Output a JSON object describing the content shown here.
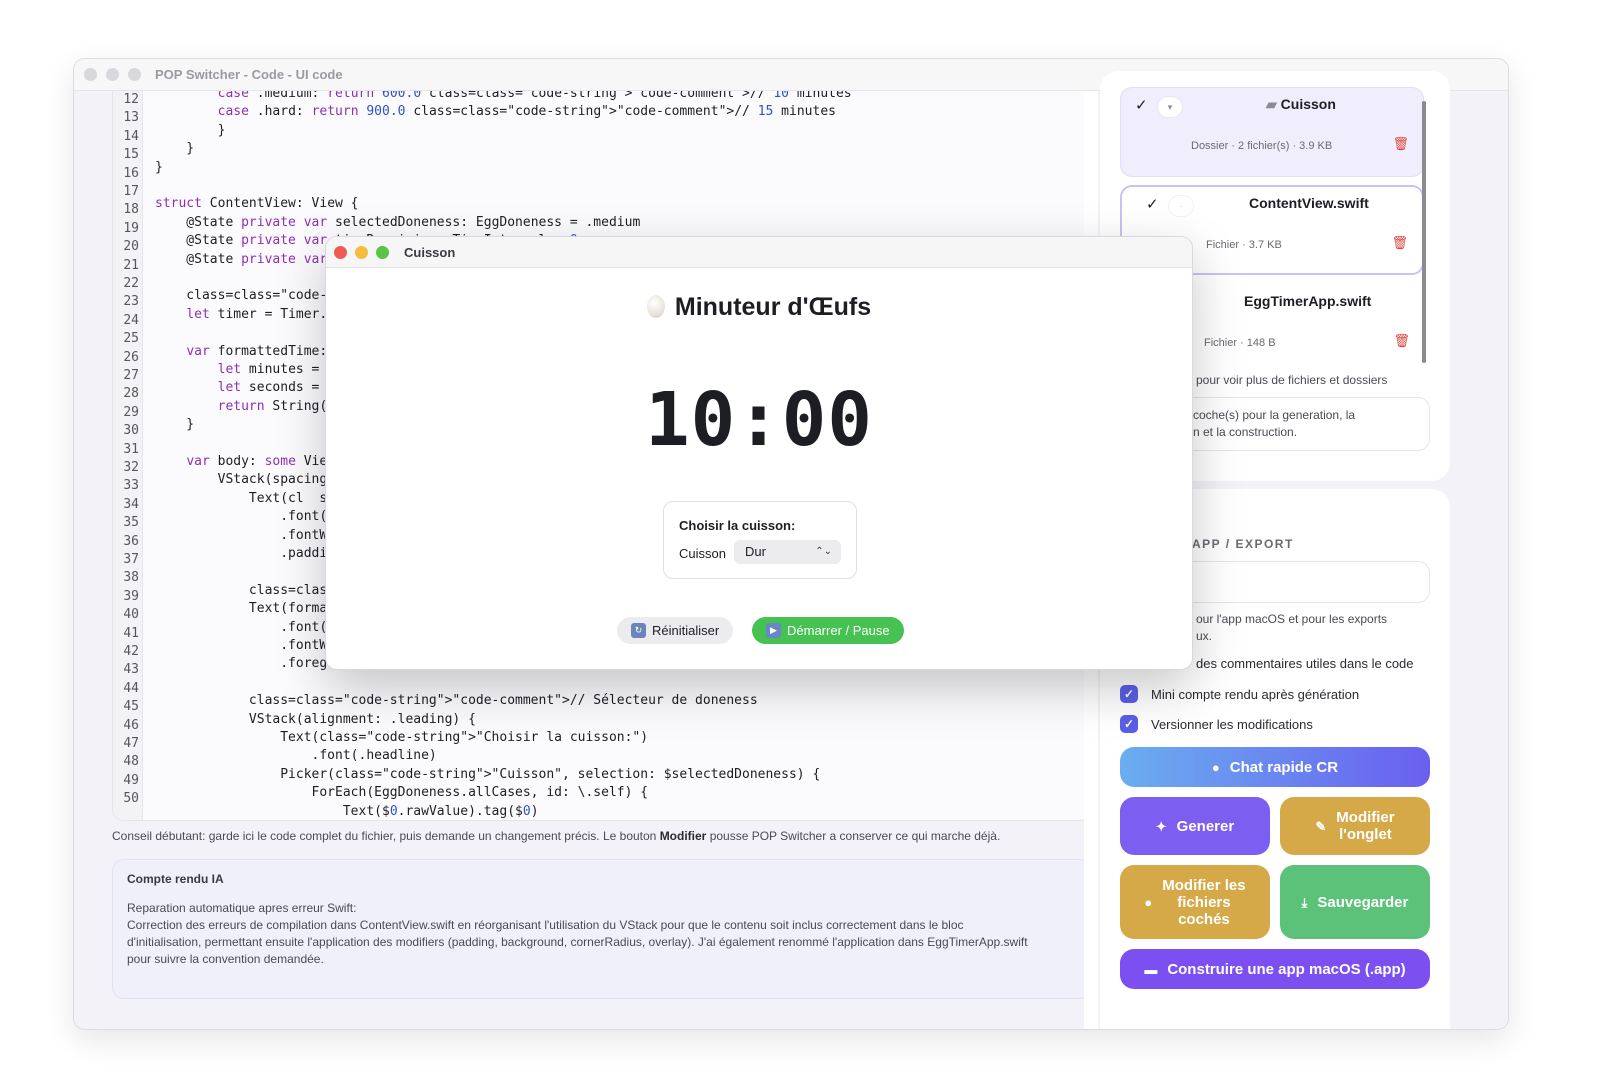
{
  "window": {
    "title": "POP Switcher - Code - UI code"
  },
  "editor": {
    "lines": [
      {
        "n": "12",
        "code": "        case .medium: return 600.0 class=class=\"code-string\">\"code-comment\">// 10 minutes"
      },
      {
        "n": "13",
        "code": "        case .hard: return 900.0 class=class=\"code-string\">\"code-comment\">// 15 minutes"
      },
      {
        "n": "14",
        "code": "        }"
      },
      {
        "n": "15",
        "code": "    }"
      },
      {
        "n": "16",
        "code": "}"
      },
      {
        "n": "17",
        "code": ""
      },
      {
        "n": "18",
        "code": "struct ContentView: View {"
      },
      {
        "n": "19",
        "code": "    @State private var selectedDoneness: EggDoneness = .medium"
      },
      {
        "n": "20",
        "code": "    @State private var timeRemaining: TimeInterval = 0"
      },
      {
        "n": "21",
        "code": "    @State private var"
      },
      {
        "n": "22",
        "code": ""
      },
      {
        "n": "23",
        "code": "    class=class=\"code-s"
      },
      {
        "n": "24",
        "code": "    let timer = Timer.p"
      },
      {
        "n": "25",
        "code": ""
      },
      {
        "n": "26",
        "code": "    var formattedTime:"
      },
      {
        "n": "27",
        "code": "        let minutes = I"
      },
      {
        "n": "28",
        "code": "        let seconds = I"
      },
      {
        "n": "29",
        "code": "        return String(f"
      },
      {
        "n": "30",
        "code": "    }"
      },
      {
        "n": "31",
        "code": ""
      },
      {
        "n": "32",
        "code": "    var body: some View"
      },
      {
        "n": "33",
        "code": "        VStack(spacing:"
      },
      {
        "n": "34",
        "code": "            Text(cl  ss="
      },
      {
        "n": "35",
        "code": "                .font(."
      },
      {
        "n": "36",
        "code": "                .fontWe"
      },
      {
        "n": "37",
        "code": "                .paddir"
      },
      {
        "n": "38",
        "code": ""
      },
      {
        "n": "39",
        "code": "            class=class"
      },
      {
        "n": "40",
        "code": "            Text(format"
      },
      {
        "n": "41",
        "code": "                .font(."
      },
      {
        "n": "42",
        "code": "                .fontWe"
      },
      {
        "n": "43",
        "code": "                .foregr"
      },
      {
        "n": "44",
        "code": ""
      },
      {
        "n": "45",
        "code": "            class=class=\"code-string\">\"code-comment\">// Sélecteur de doneness"
      },
      {
        "n": "46",
        "code": "            VStack(alignment: .leading) {"
      },
      {
        "n": "47",
        "code": "                Text(class=\"code-string\">\"Choisir la cuisson:\")"
      },
      {
        "n": "48",
        "code": "                    .font(.headline)"
      },
      {
        "n": "49",
        "code": "                Picker(class=\"code-string\">\"Cuisson\", selection: $selectedDoneness) {"
      },
      {
        "n": "50",
        "code": "                    ForEach(EggDoneness.allCases, id: \\.self) {"
      },
      {
        "n": "",
        "code": "                        Text($0.rawValue).tag($0)"
      }
    ]
  },
  "hint": {
    "before": "Conseil débutant: garde ici le code complet du fichier, puis demande un changement précis. Le bouton ",
    "bold": "Modifier",
    "after": " pousse POP Switcher a conserver ce qui marche déjà."
  },
  "report": {
    "title": "Compte rendu IA",
    "line1": "Reparation automatique apres erreur Swift:",
    "line2": "Correction des erreurs de compilation dans ContentView.swift en réorganisant l'utilisation du VStack pour que le contenu soit inclus correctement dans le bloc",
    "line3": "d'initialisation, permettant ensuite l'application des modifiers (padding, background, cornerRadius, overlay). J'ai également renommé l'application dans EggTimerApp.swift",
    "line4": "pour suivre la convention demandée."
  },
  "files": [
    {
      "name": "Cuisson",
      "meta": "Dossier · 2 fichier(s) · 3.9 KB",
      "check": "✓",
      "icon": "folder-icon"
    },
    {
      "name": "ContentView.swift",
      "meta": "Fichier · 3.7 KB",
      "check": "✓"
    },
    {
      "name": "EggTimerApp.swift",
      "meta": "Fichier · 148 B",
      "check": ""
    }
  ],
  "right_panel": {
    "more_files": "pour voir plus de fichiers et dossiers",
    "note_l1": "coche(s) pour la generation, la",
    "note_l2": "n et la construction.",
    "section": "APP / EXPORT",
    "export_l1": "our l'app macOS et pour les exports",
    "export_l2": "ux.",
    "comments_opt": "des commentaires utiles dans le code",
    "options": [
      {
        "label": "Mini compte rendu après génération",
        "checked": true
      },
      {
        "label": "Versionner les modifications",
        "checked": true
      }
    ]
  },
  "buttons": {
    "chat": "Chat rapide CR",
    "generate": "Generer",
    "modify_l1": "Modifier",
    "modify_l2": "l'onglet",
    "modify_files_l1": "Modifier les",
    "modify_files_l2": "fichiers",
    "modify_files_l3": "cochés",
    "save": "Sauvegarder",
    "build": "Construire une app macOS (.app)"
  },
  "egg_app": {
    "window_title": "Cuisson",
    "heading": "Minuteur d'Œufs",
    "timer": "10:00",
    "picker_title": "Choisir la cuisson:",
    "picker_label": "Cuisson",
    "picker_value": "Dur",
    "reset": "Réinitialiser",
    "start": "Démarrer / Pause"
  },
  "colors": {
    "accent": "#5b5fe8",
    "generate": "#7c5ff0",
    "modify": "#d6a948",
    "save": "#5cc27a",
    "start": "#46c253",
    "delete": "#e0443a"
  }
}
